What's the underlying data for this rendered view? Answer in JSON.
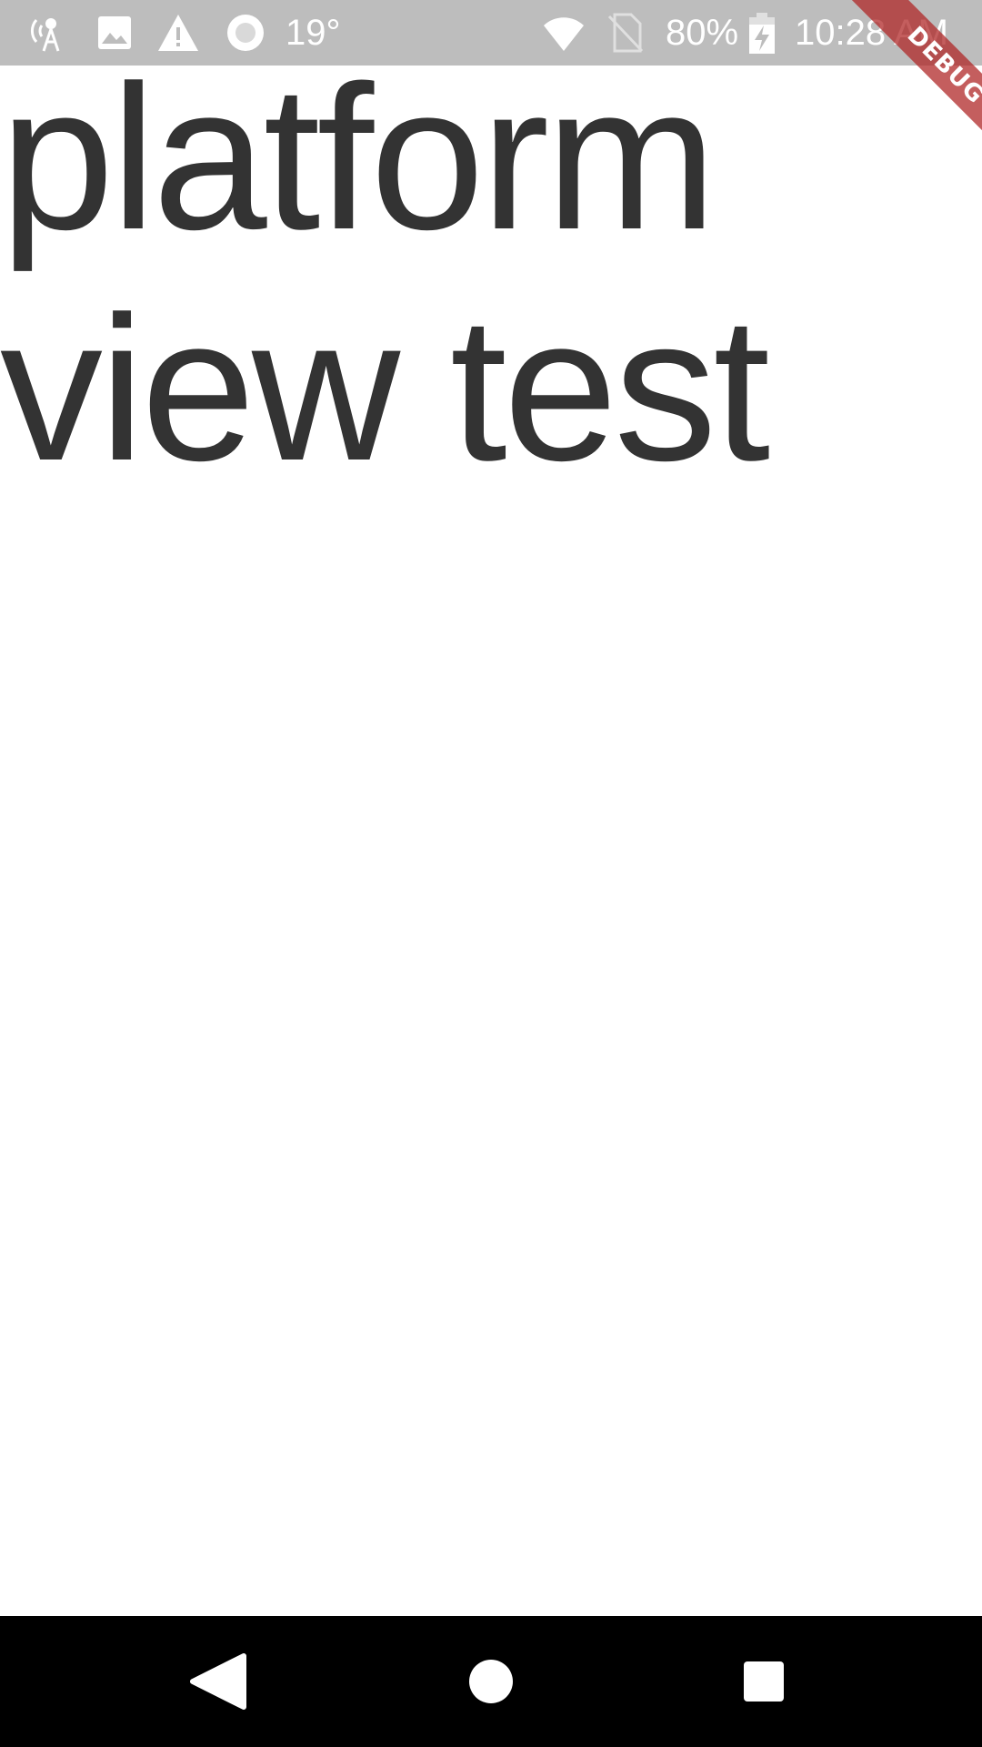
{
  "status_bar": {
    "temperature": "19°",
    "battery_percent": "80%",
    "time": "10:28 AM",
    "icons": [
      "radio-tower-icon",
      "image-icon",
      "warning-icon",
      "circle-icon",
      "wifi-icon",
      "no-sim-icon",
      "battery-charging-icon"
    ],
    "background_color": "#bdbdbd"
  },
  "content": {
    "text": "platform view test",
    "text_color": "#333333"
  },
  "debug_banner": {
    "label": "DEBUG",
    "color": "#b02828"
  },
  "nav_bar": {
    "buttons": [
      "back-icon",
      "home-icon",
      "recents-icon"
    ],
    "background_color": "#000000"
  }
}
